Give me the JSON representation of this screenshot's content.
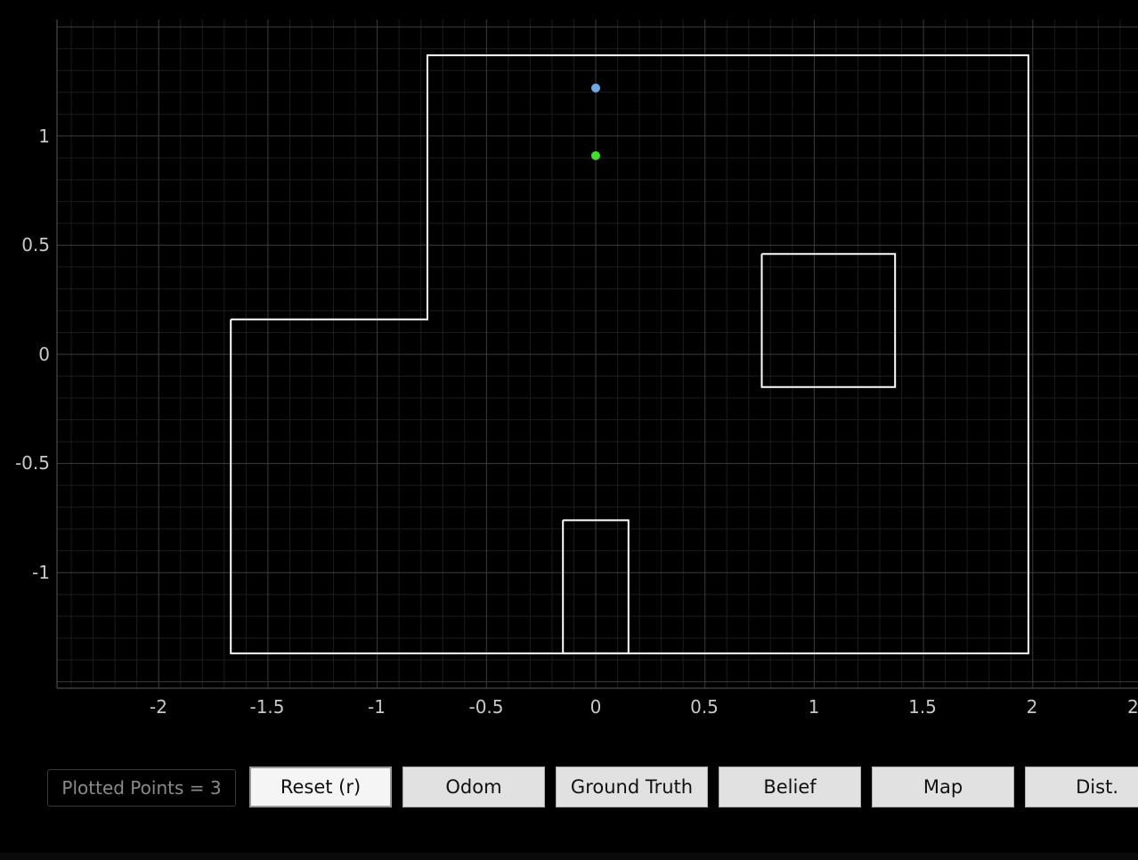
{
  "plot": {
    "x_ticks": [
      "-2",
      "-1.5",
      "-1",
      "-0.5",
      "0",
      "0.5",
      "1",
      "1.5",
      "2",
      "2"
    ],
    "y_ticks": [
      "1",
      "0.5",
      "0",
      "-0.5",
      "-1"
    ],
    "colors": {
      "background": "#000000",
      "major_grid": "#3c3c3c",
      "minor_grid": "#1c1c1c",
      "map_lines": "#ffffff",
      "odom_point": "#6ea8e6",
      "ground_truth_point": "#3fe02a"
    }
  },
  "map": {
    "outer_boundary": [
      [
        -1.67,
        0.16
      ],
      [
        -0.77,
        0.16
      ],
      [
        -0.77,
        1.37
      ],
      [
        1.98,
        1.37
      ],
      [
        1.98,
        -1.37
      ],
      [
        -1.67,
        -1.37
      ],
      [
        -1.67,
        0.16
      ]
    ],
    "obstacles": [
      [
        [
          0.76,
          0.46
        ],
        [
          1.37,
          0.46
        ],
        [
          1.37,
          -0.15
        ],
        [
          0.76,
          -0.15
        ],
        [
          0.76,
          0.46
        ]
      ],
      [
        [
          -0.15,
          -0.76
        ],
        [
          0.15,
          -0.76
        ],
        [
          0.15,
          -1.37
        ],
        [
          -0.15,
          -1.37
        ],
        [
          -0.15,
          -0.76
        ]
      ]
    ]
  },
  "points": [
    {
      "series": "odom",
      "x": 0.0,
      "y": 1.22
    },
    {
      "series": "ground_truth",
      "x": 0.0,
      "y": 0.91
    }
  ],
  "status": {
    "plotted_points": "Plotted Points = 3"
  },
  "toolbar": {
    "reset_label": "Reset (r)",
    "odom_label": "Odom",
    "ground_truth_label": "Ground Truth",
    "belief_label": "Belief",
    "map_label": "Map",
    "dist_label": "Dist."
  }
}
